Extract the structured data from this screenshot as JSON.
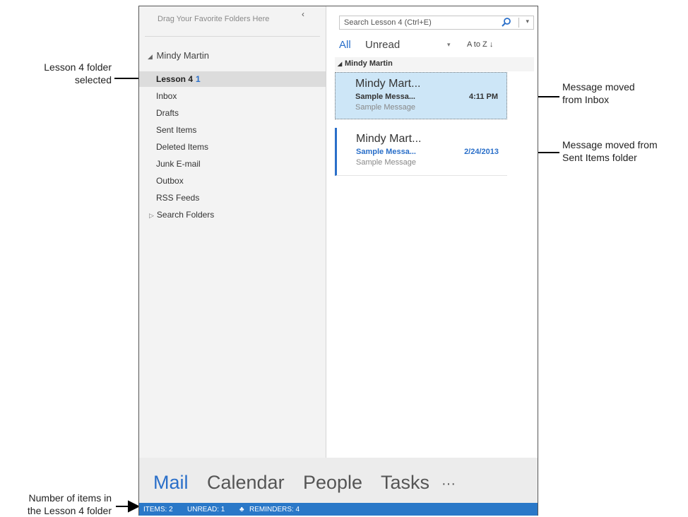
{
  "callouts": {
    "lesson_folder_line1": "Lesson 4 folder",
    "lesson_folder_line2": "selected",
    "moved_inbox_line1": "Message moved",
    "moved_inbox_line2": "from Inbox",
    "moved_sent_line1": "Message moved from",
    "moved_sent_line2": "Sent Items folder",
    "count_line1": "Number of items in",
    "count_line2": "the Lesson 4 folder"
  },
  "folder_pane": {
    "favorites_hint": "Drag Your Favorite Folders Here",
    "collapse_icon": "chevron-left-icon",
    "account": "Mindy Martin",
    "folders": [
      {
        "label": "Lesson 4",
        "count": "1"
      },
      {
        "label": "Inbox"
      },
      {
        "label": "Drafts"
      },
      {
        "label": "Sent Items"
      },
      {
        "label": "Deleted Items"
      },
      {
        "label": "Junk E-mail"
      },
      {
        "label": "Outbox"
      },
      {
        "label": "RSS Feeds"
      },
      {
        "label": "Search Folders"
      }
    ]
  },
  "message_pane": {
    "search_placeholder": "Search Lesson 4 (Ctrl+E)",
    "filter_all": "All",
    "filter_unread": "Unread",
    "sort": "A to Z",
    "group": "Mindy Martin",
    "messages": [
      {
        "from": "Mindy Mart...",
        "subject": "Sample Messa...",
        "preview": "Sample Message",
        "time": "4:11 PM"
      },
      {
        "from": "Mindy Mart...",
        "subject": "Sample Messa...",
        "preview": "Sample Message",
        "time": "2/24/2013"
      }
    ]
  },
  "nav": {
    "mail": "Mail",
    "calendar": "Calendar",
    "people": "People",
    "tasks": "Tasks",
    "more": "···"
  },
  "status": {
    "items": "ITEMS: 2",
    "unread": "UNREAD: 1",
    "reminders": "REMINDERS: 4"
  },
  "colors": {
    "accent": "#2a6fc9",
    "status_bar": "#2a78c8",
    "selected_message": "#cde6f7"
  }
}
